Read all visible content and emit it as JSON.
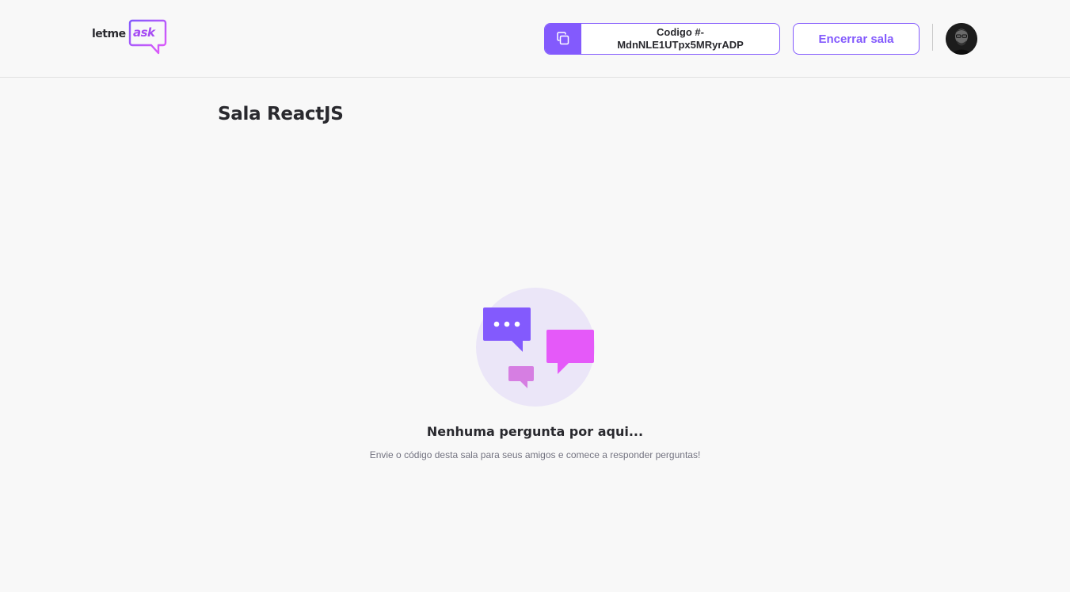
{
  "header": {
    "logo": {
      "part1": "letme",
      "part2": "ask"
    },
    "room_code": {
      "line1": "Codigo #-",
      "line2": "MdnNLE1UTpx5MRyrADP",
      "icon": "copy-icon"
    },
    "close_room_label": "Encerrar sala",
    "avatar_icon": "user-avatar"
  },
  "main": {
    "title": "Sala ReactJS",
    "empty_state": {
      "icon": "chat-bubbles-illustration",
      "title": "Nenhuma pergunta por aqui...",
      "subtitle": "Envie o código desta sala para seus amigos e comece a responder perguntas!"
    }
  },
  "colors": {
    "primary": "#835afd",
    "accent": "#e559f9",
    "background": "#f8f8f8",
    "text": "#29292e",
    "muted": "#737380"
  }
}
